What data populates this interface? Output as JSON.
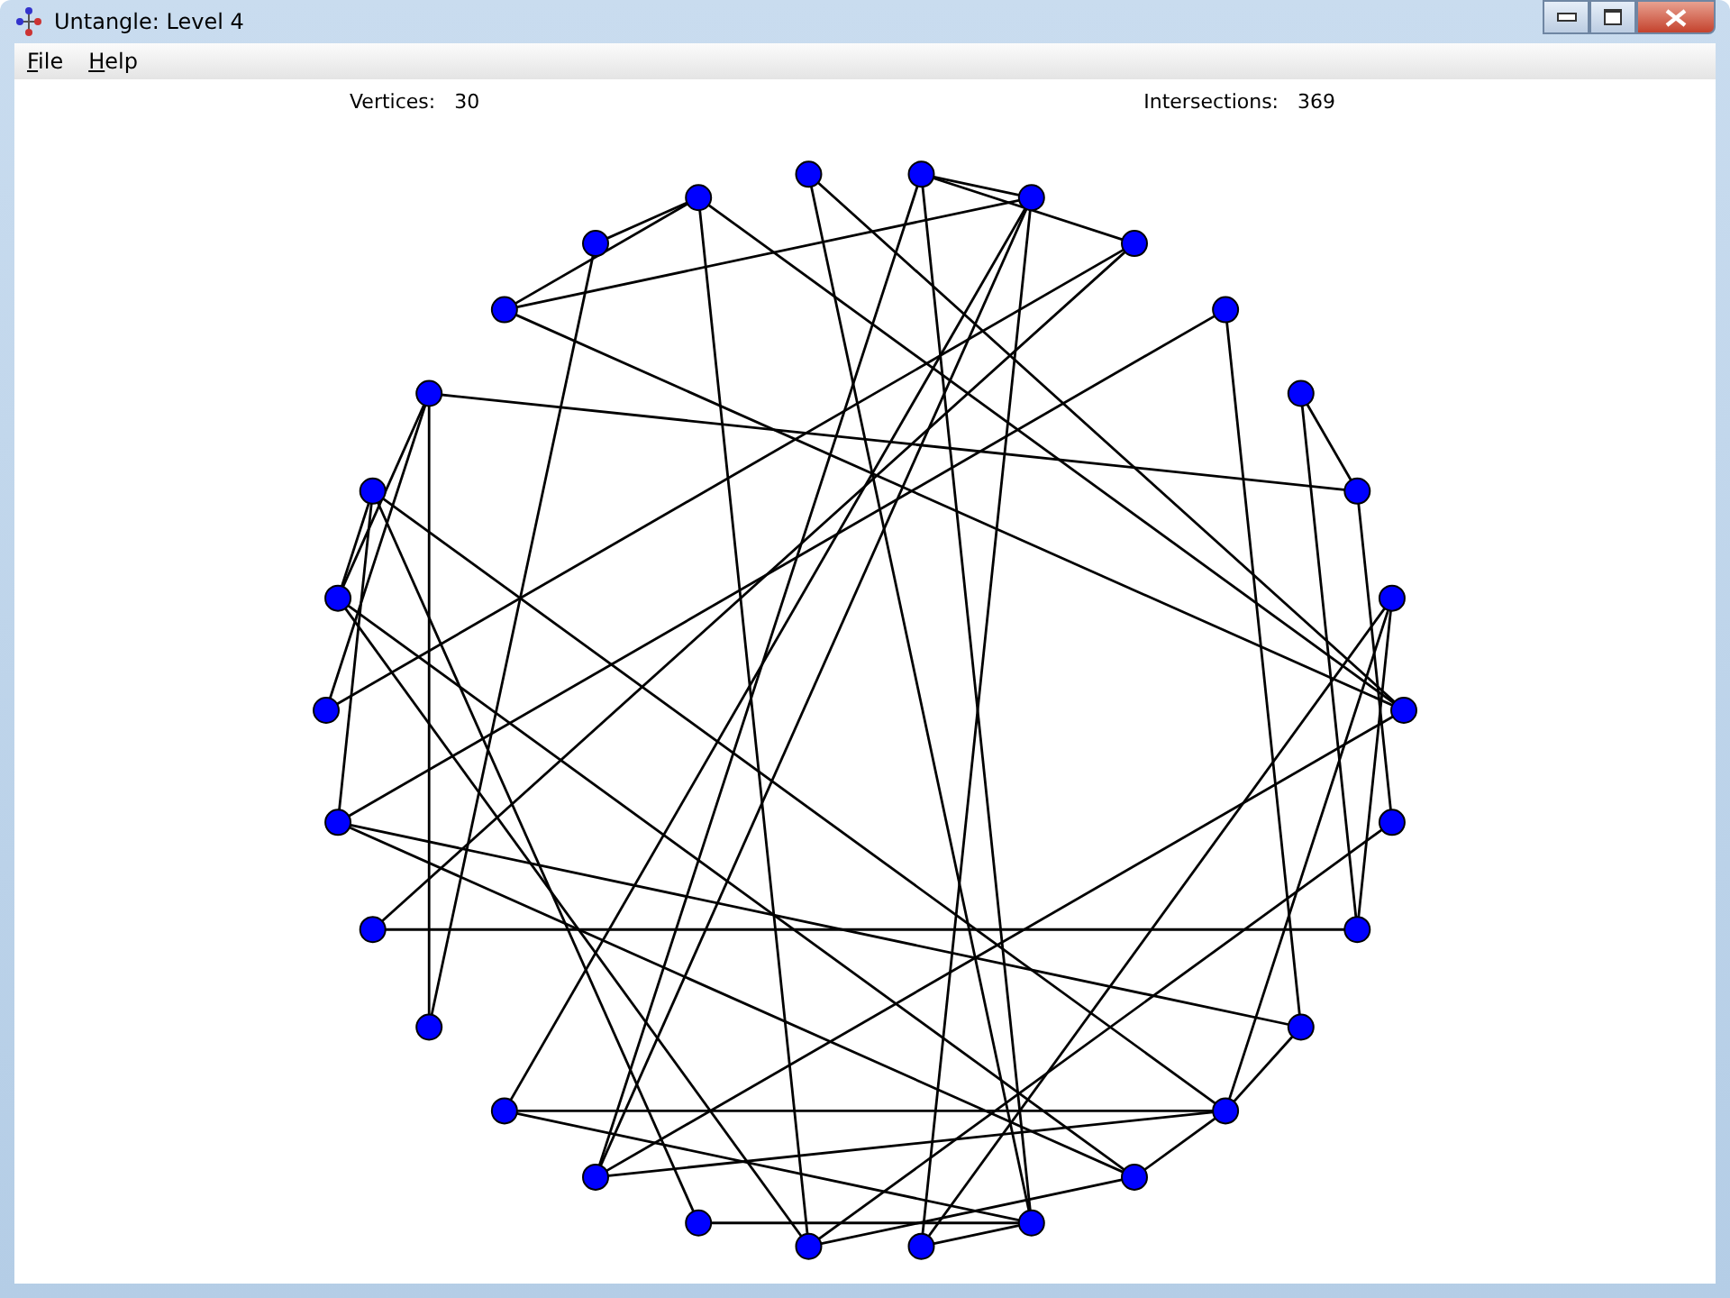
{
  "window": {
    "title": "Untangle: Level 4"
  },
  "menu": [
    {
      "label": "File"
    },
    {
      "label": "Help"
    }
  ],
  "stats": [
    {
      "label": "Vertices:",
      "value": "30"
    },
    {
      "label": "Intersections:",
      "value": "369"
    }
  ]
}
